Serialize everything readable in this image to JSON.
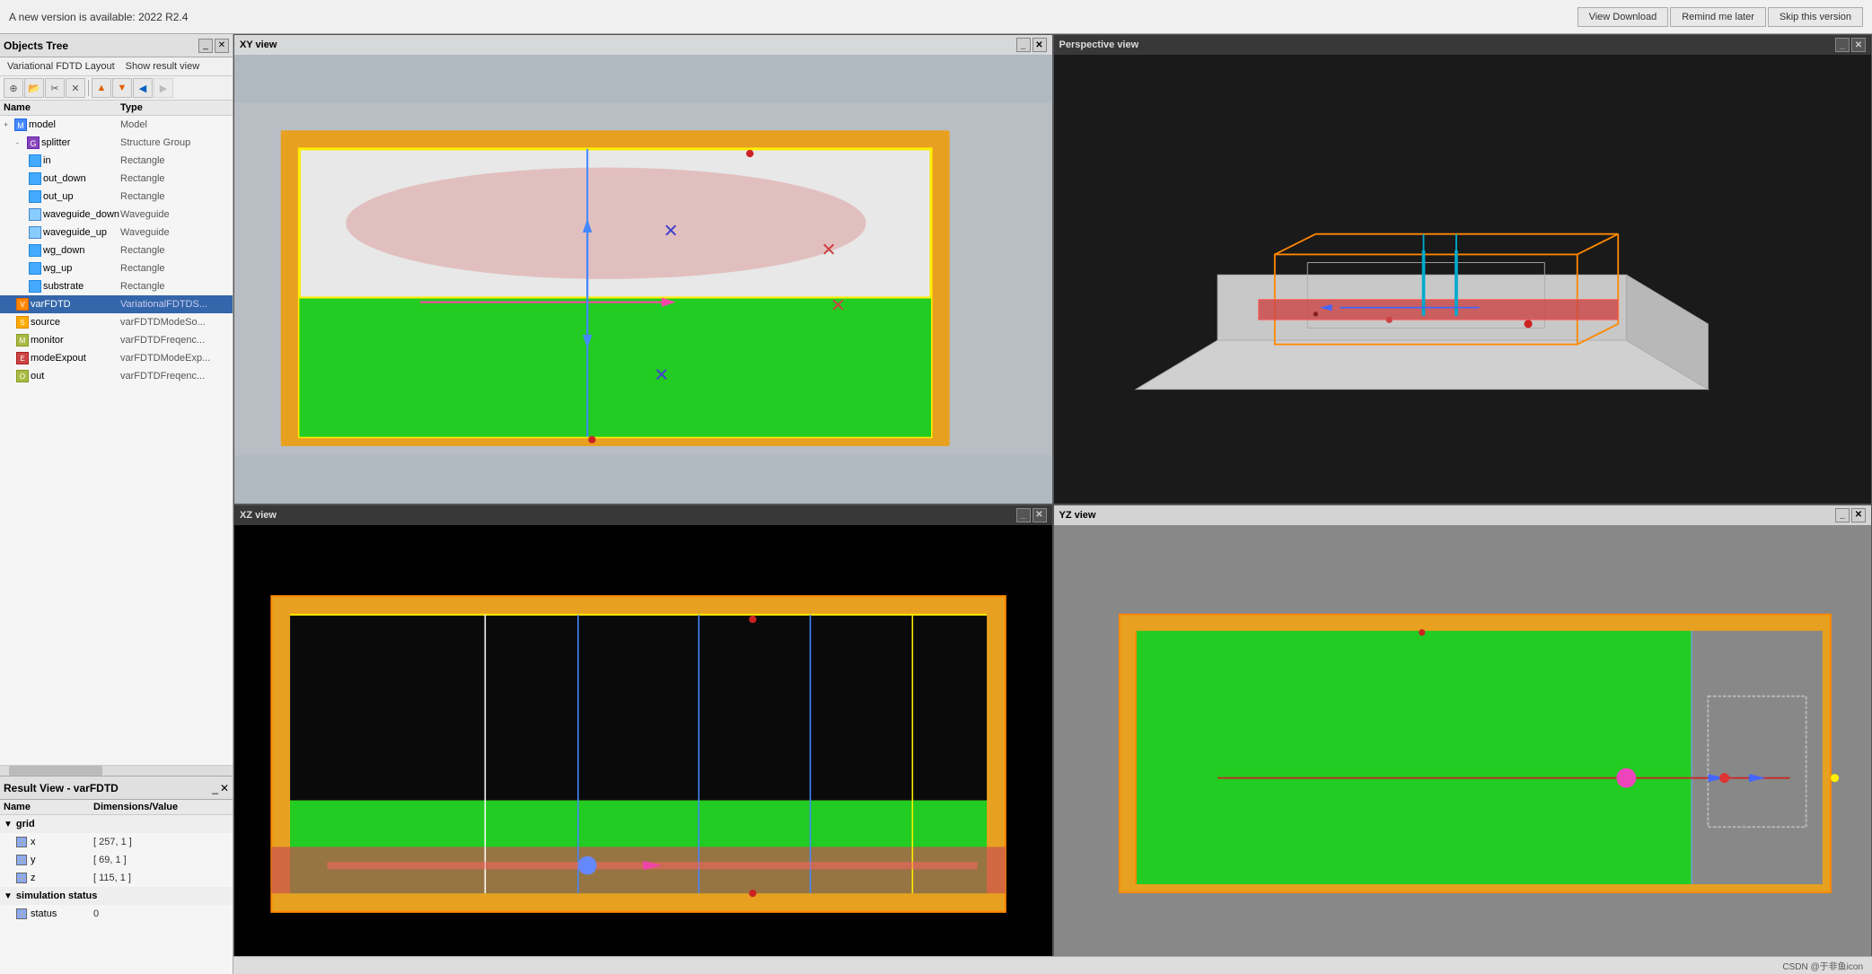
{
  "update_bar": {
    "message": "A new version is available: 2022 R2.4",
    "view_download": "View Download",
    "remind_later": "Remind me later",
    "skip_version": "Skip this version"
  },
  "objects_tree": {
    "title": "Objects Tree",
    "menu": [
      "Variational FDTD Layout",
      "Show result view"
    ],
    "toolbar": {
      "buttons": [
        "⊕",
        "📁",
        "✂",
        "✕",
        "↑",
        "↓",
        "←",
        "→",
        "⬡"
      ]
    },
    "columns": [
      "Name",
      "Type"
    ],
    "rows": [
      {
        "indent": 0,
        "expand": "+",
        "icon": "model",
        "name": "model",
        "type": "Model"
      },
      {
        "indent": 1,
        "expand": "-",
        "icon": "group",
        "name": "splitter",
        "type": "Structure Group"
      },
      {
        "indent": 2,
        "expand": "",
        "icon": "rect",
        "name": "in",
        "type": "Rectangle"
      },
      {
        "indent": 2,
        "expand": "",
        "icon": "rect",
        "name": "out_down",
        "type": "Rectangle"
      },
      {
        "indent": 2,
        "expand": "",
        "icon": "rect",
        "name": "out_up",
        "type": "Rectangle"
      },
      {
        "indent": 2,
        "expand": "",
        "icon": "wave",
        "name": "waveguide_down",
        "type": "Waveguide"
      },
      {
        "indent": 2,
        "expand": "",
        "icon": "wave",
        "name": "waveguide_up",
        "type": "Waveguide"
      },
      {
        "indent": 2,
        "expand": "",
        "icon": "rect",
        "name": "wg_down",
        "type": "Rectangle"
      },
      {
        "indent": 2,
        "expand": "",
        "icon": "rect",
        "name": "wg_up",
        "type": "Rectangle"
      },
      {
        "indent": 2,
        "expand": "",
        "icon": "rect",
        "name": "substrate",
        "type": "Rectangle"
      },
      {
        "indent": 1,
        "expand": "",
        "icon": "varfdtd",
        "name": "varFDTD",
        "type": "VariationalFDTDS...",
        "selected": true
      },
      {
        "indent": 1,
        "expand": "",
        "icon": "source",
        "name": "source",
        "type": "varFDTDModeSo..."
      },
      {
        "indent": 1,
        "expand": "",
        "icon": "monitor",
        "name": "monitor",
        "type": "varFDTDFreqenc..."
      },
      {
        "indent": 1,
        "expand": "",
        "icon": "modeexp",
        "name": "modeExpout",
        "type": "varFDTDModeExp..."
      },
      {
        "indent": 1,
        "expand": "",
        "icon": "out",
        "name": "out",
        "type": "varFDTDFreqenc..."
      }
    ]
  },
  "result_view": {
    "title": "Result View - varFDTD",
    "columns": [
      "Name",
      "Dimensions/Value"
    ],
    "groups": [
      {
        "name": "grid",
        "items": [
          {
            "name": "x",
            "value": "[ 257, 1 ]",
            "icon": "grid"
          },
          {
            "name": "y",
            "value": "[ 69, 1 ]",
            "icon": "grid"
          },
          {
            "name": "z",
            "value": "[ 115, 1 ]",
            "icon": "grid"
          }
        ]
      },
      {
        "name": "simulation status",
        "items": [
          {
            "name": "status",
            "value": "0",
            "icon": "grid"
          }
        ]
      }
    ]
  },
  "viewports": {
    "xy": {
      "title": "XY view"
    },
    "perspective": {
      "title": "Perspective view"
    },
    "xz": {
      "title": "XZ view"
    },
    "yz": {
      "title": "YZ view"
    }
  },
  "status_bar": {
    "watermark": "CSDN @于非鱼icon"
  }
}
